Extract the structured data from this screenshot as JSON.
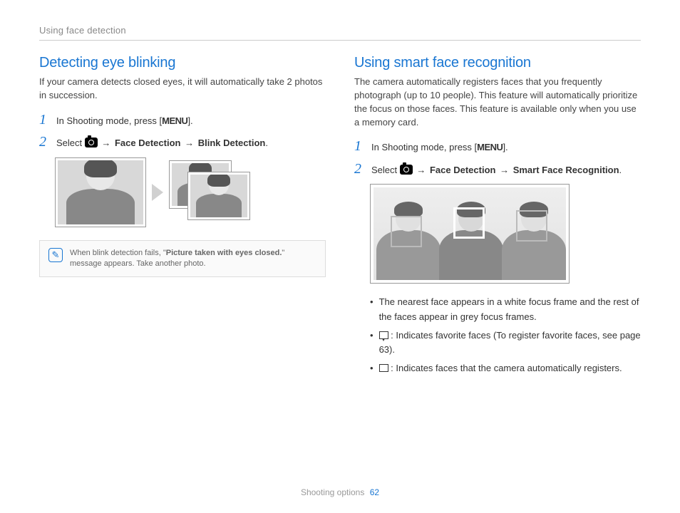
{
  "breadcrumb": "Using face detection",
  "footer": {
    "section": "Shooting options",
    "page": "62"
  },
  "left": {
    "title": "Detecting eye blinking",
    "intro": "If your camera detects closed eyes, it will automatically take 2 photos in succession.",
    "step1_pre": "In Shooting mode, press [",
    "step1_menu": "MENU",
    "step1_post": "].",
    "step2_pre": "Select ",
    "step2_arrow1": " → ",
    "step2_b1": "Face Detection",
    "step2_arrow2": " → ",
    "step2_b2": "Blink Detection",
    "step2_post": ".",
    "note_pre": "When blink detection fails, \"",
    "note_bold": "Picture taken with eyes closed.",
    "note_post": "\" message appears. Take another photo."
  },
  "right": {
    "title": "Using smart face recognition",
    "intro": "The camera automatically registers faces that you frequently photograph (up to 10 people). This feature will automatically prioritize the focus on those faces. This feature is available only when you use a memory card.",
    "step1_pre": "In Shooting mode, press [",
    "step1_menu": "MENU",
    "step1_post": "].",
    "step2_pre": "Select ",
    "step2_arrow1": " → ",
    "step2_b1": "Face Detection",
    "step2_arrow2": " → ",
    "step2_b2": "Smart Face Recognition",
    "step2_post": ".",
    "bullet1": "The nearest face appears in a white focus frame and the rest of the faces appear in grey focus frames.",
    "bullet2": " : Indicates favorite faces (To register favorite faces, see page 63).",
    "bullet3": " : Indicates faces that the camera automatically registers."
  }
}
